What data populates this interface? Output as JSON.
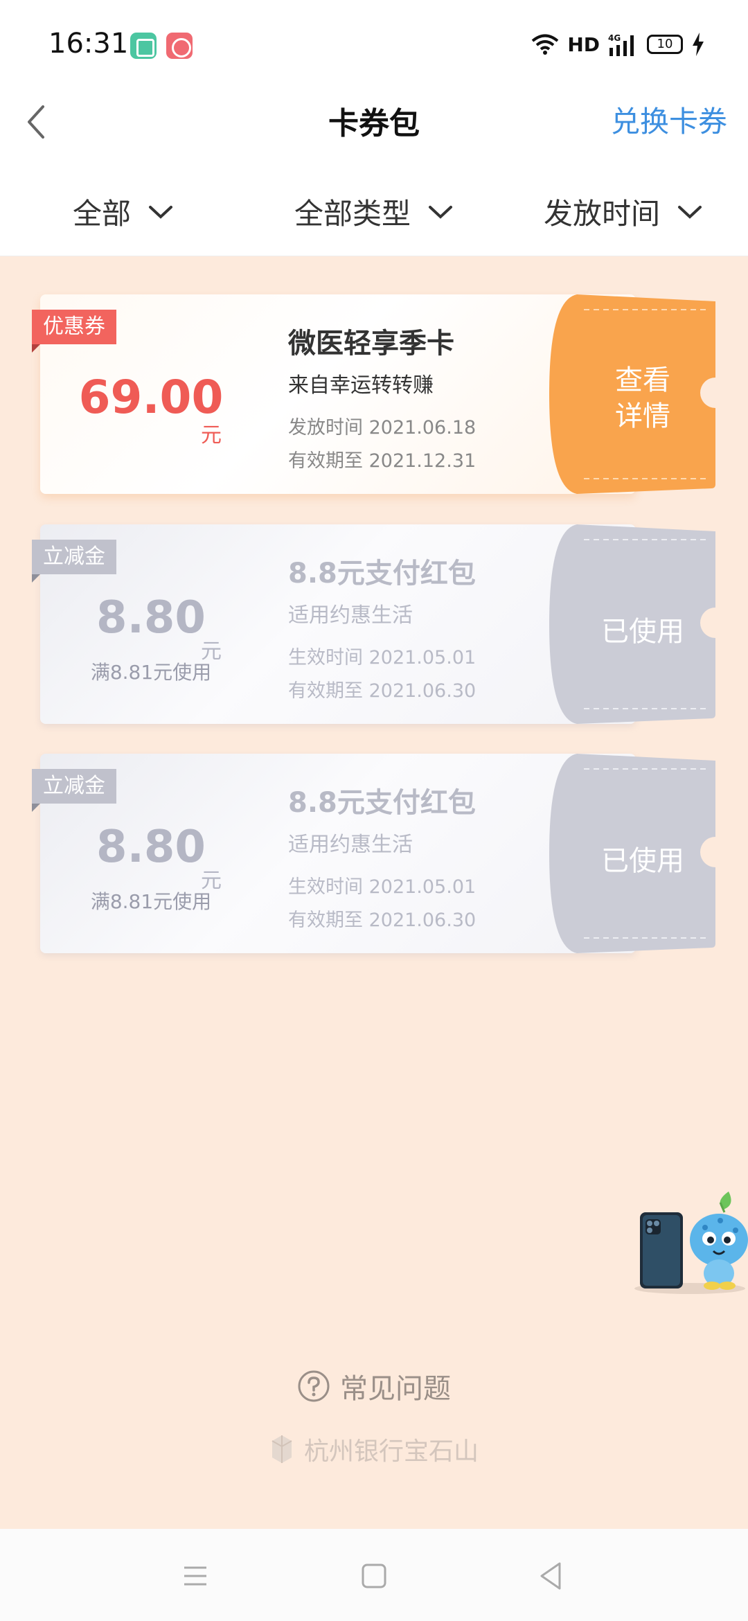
{
  "status": {
    "time": "16:31",
    "network": "HD",
    "battery": "10"
  },
  "header": {
    "title": "卡券包",
    "action": "兑换卡券"
  },
  "filters": [
    {
      "label": "全部"
    },
    {
      "label": "全部类型"
    },
    {
      "label": "发放时间"
    }
  ],
  "coupons": [
    {
      "tag": "优惠券",
      "amount": "69.00",
      "unit": "元",
      "min_spend": "",
      "title": "微医轻享季卡",
      "source": "来自幸运转转赚",
      "date1": "发放时间 2021.06.18",
      "date2": "有效期至 2021.12.31",
      "action": "查看\n详情",
      "status": "active",
      "accent": "#f7a24d"
    },
    {
      "tag": "立减金",
      "amount": "8.80",
      "unit": "元",
      "min_spend": "满8.81元使用",
      "title": "8.8元支付红包",
      "source": "适用约惠生活",
      "date1": "生效时间 2021.05.01",
      "date2": "有效期至 2021.06.30",
      "action": "已使用",
      "status": "used",
      "accent": "#cbccd6"
    },
    {
      "tag": "立减金",
      "amount": "8.80",
      "unit": "元",
      "min_spend": "满8.81元使用",
      "title": "8.8元支付红包",
      "source": "适用约惠生活",
      "date1": "生效时间 2021.05.01",
      "date2": "有效期至 2021.06.30",
      "action": "已使用",
      "status": "used",
      "accent": "#cbccd6"
    }
  ],
  "footer": {
    "faq": "常见问题",
    "bank": "杭州银行宝石山"
  }
}
